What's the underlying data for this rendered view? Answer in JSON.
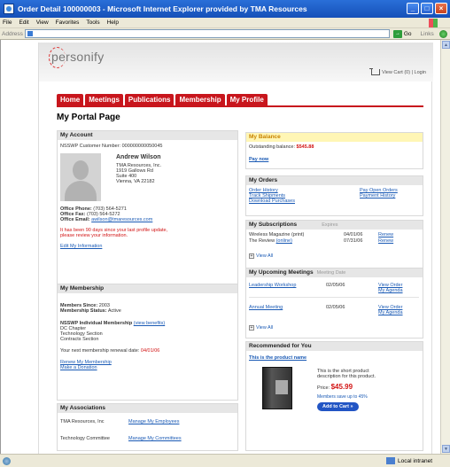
{
  "window": {
    "title": "Order Detail 100000003 - Microsoft Internet Explorer provided by TMA Resources",
    "menu": [
      "File",
      "Edit",
      "View",
      "Favorites",
      "Tools",
      "Help"
    ],
    "address_label": "Address",
    "go_label": "Go",
    "links_label": "Links",
    "status_zone": "Local intranet"
  },
  "header": {
    "logo": "personify",
    "cart_links": "View Cart (0) | Login"
  },
  "nav": [
    "Home",
    "Meetings",
    "Publications",
    "Membership",
    "My Profile"
  ],
  "page_title": "My Portal Page",
  "account": {
    "title": "My Account",
    "customer_number": "NSSWP Customer Number: 000000000050045",
    "name": "Andrew Wilson",
    "address": [
      "TMA Resources, Inc.",
      "1919 Gallows Rd",
      "Suite 400",
      "Vienna, VA 22182"
    ],
    "phone_label": "Office Phone:",
    "phone": "(703) 564-5271",
    "fax_label": "Office Fax:",
    "fax": "(703) 564-5272",
    "email_label": "Office Email:",
    "email": "awilson@tmaresources.com",
    "notice_line1": "It has been 90 days since your last profile update,",
    "notice_line2": "please review your information.",
    "edit_link": "Edit My Information"
  },
  "membership": {
    "title": "My Membership",
    "since_label": "Members Since:",
    "since": "2003",
    "status_label": "Membership Status:",
    "status": "Active",
    "type_label": "NSSWP Individual Membership",
    "benefits_link": "(view benefits)",
    "sections": [
      "DC Chapter",
      "Technology Section",
      "Contracts Section"
    ],
    "renewal_text": "Your next membership renewal date:",
    "renewal_date": "04/01/06",
    "renew_link": "Renew My Membership",
    "donate_link": "Make a Donation"
  },
  "associations": {
    "title": "My Associations",
    "rows": [
      {
        "name": "TMA Resources, Inc",
        "link": "Manage My Employees"
      },
      {
        "name": "Technology Committee",
        "link": "Manage My Committees"
      }
    ]
  },
  "balance": {
    "title": "My Balance",
    "label": "Outstanding balance:",
    "amount": "$545.88",
    "pay_link": "Pay now"
  },
  "orders": {
    "title": "My Orders",
    "links": [
      "Order History",
      "Track Shipments",
      "Download Purchases",
      "Pay Open Orders",
      "Payment History"
    ]
  },
  "subscriptions": {
    "title": "My Subscriptions",
    "col": "Expires",
    "rows": [
      {
        "name": "Wireless Magazine (print)",
        "date": "04/01/06",
        "action": "Renew"
      },
      {
        "name": "The Review",
        "name_link": "(online)",
        "date": "07/31/06",
        "action": "Renew"
      }
    ],
    "view_all": "View All"
  },
  "meetings": {
    "title": "My Upcoming Meetings",
    "col": "Meeting Date",
    "rows": [
      {
        "name": "Leadership Workshop",
        "date": "02/05/06",
        "link1": "View Order",
        "link2": "My Agenda"
      },
      {
        "name": "Annual Meeting",
        "date": "02/05/06",
        "link1": "View Order",
        "link2": "My Agenda"
      }
    ],
    "view_all": "View All"
  },
  "recommended": {
    "title": "Recommended for You",
    "product_link": "This is the product name",
    "desc_line1": "This is the short product",
    "desc_line2": "description for this product.",
    "price_label": "Price:",
    "price": "$45.99",
    "save_text": "Members save up to 45%",
    "add_button": "Add to Cart"
  },
  "colors": {
    "brand_red": "#c8161d",
    "link_blue": "#1a5ab5",
    "balance_yellow": "#fff6b5"
  }
}
